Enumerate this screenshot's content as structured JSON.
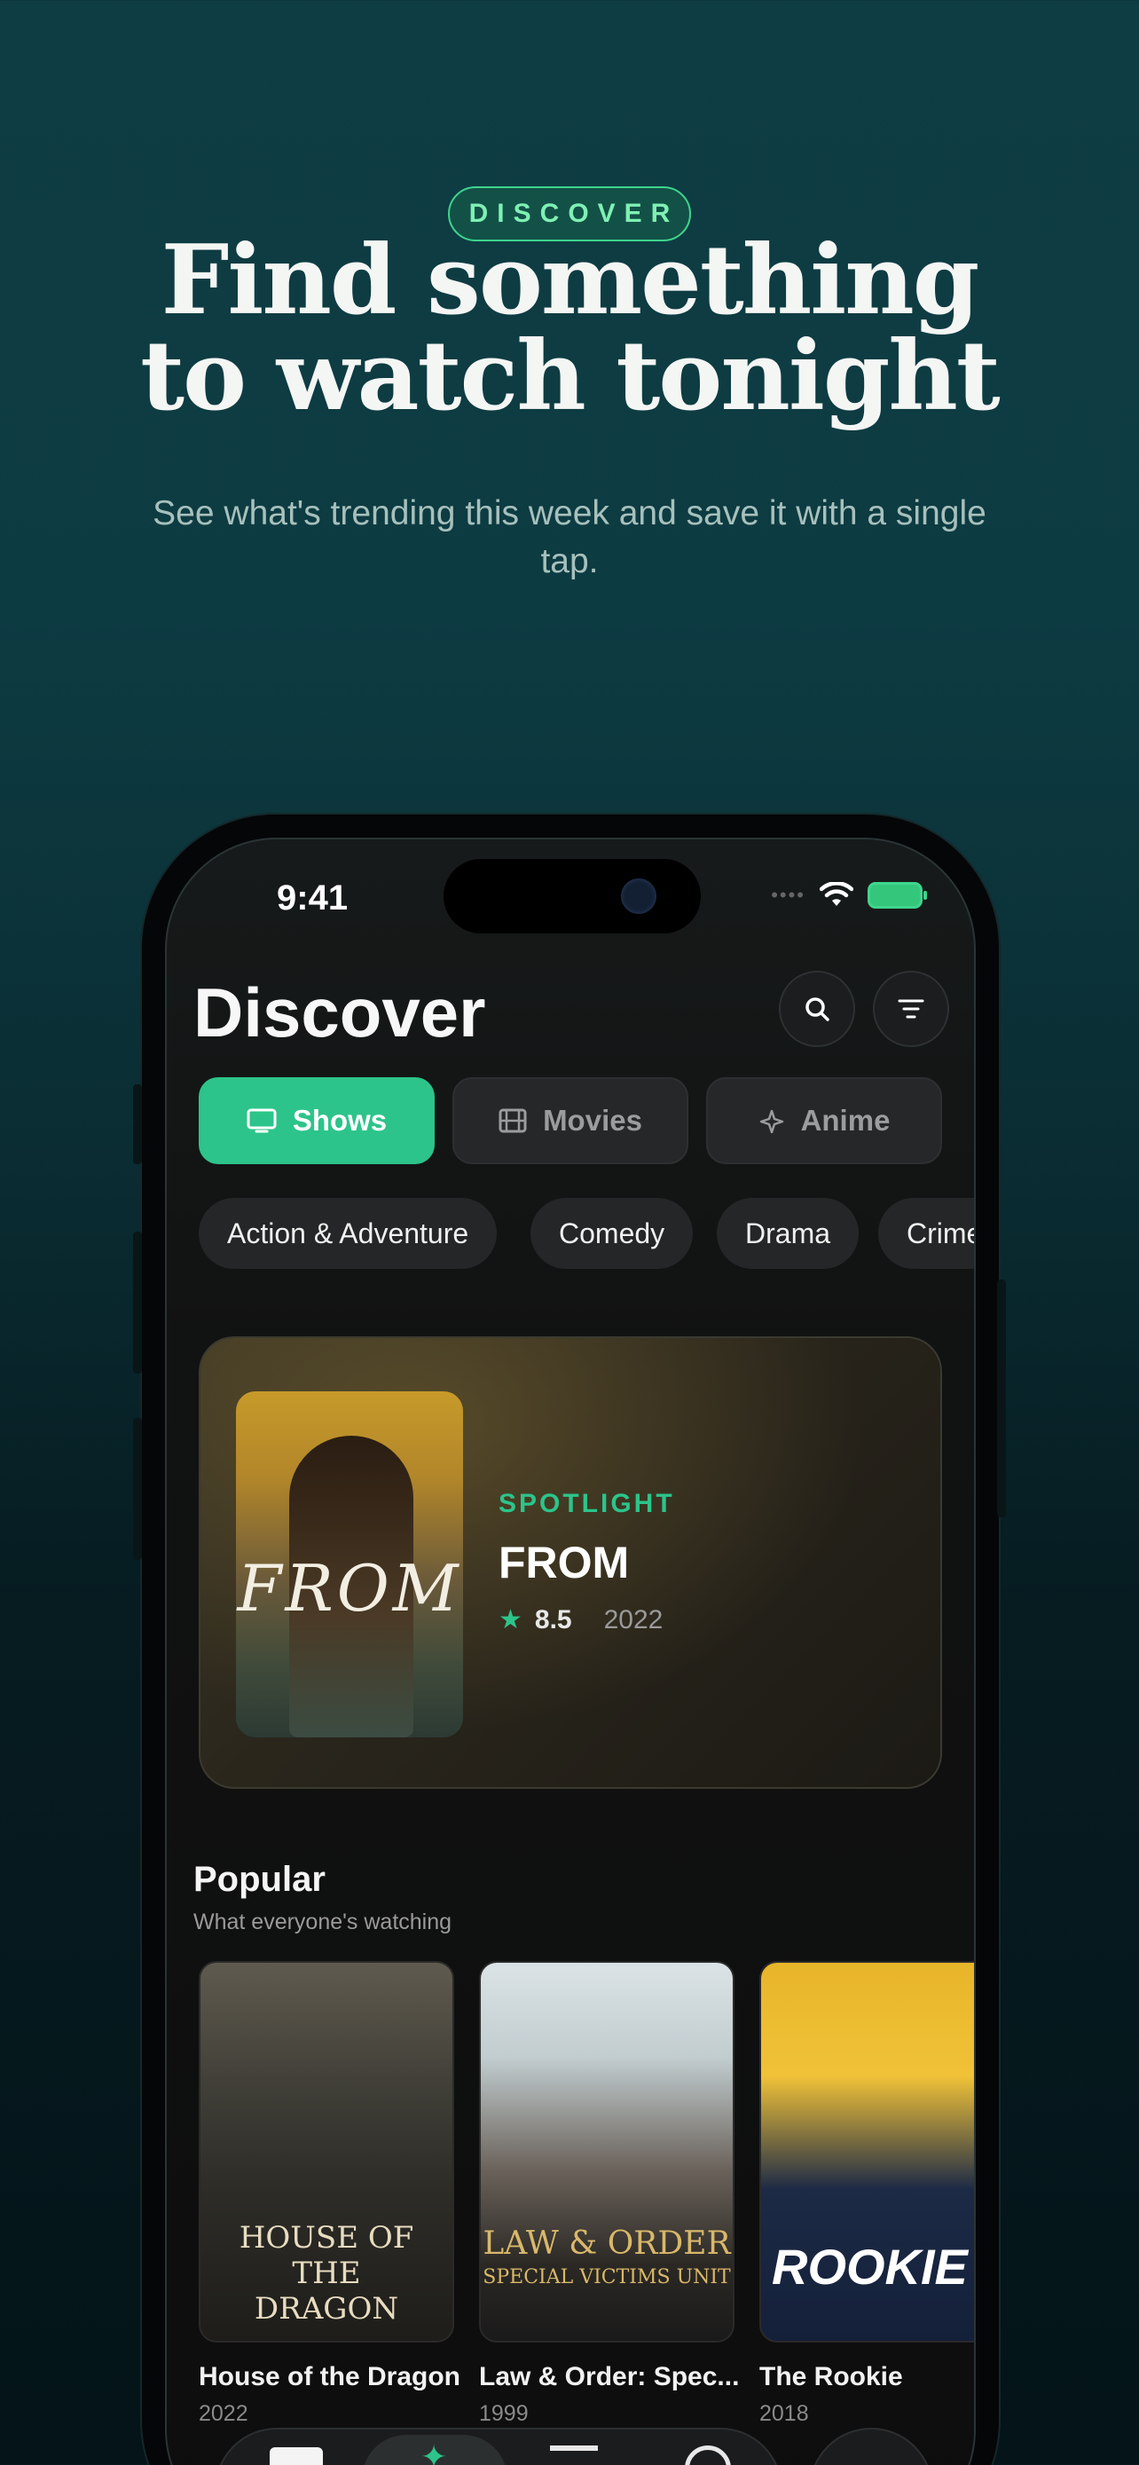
{
  "hero": {
    "badge": "DISCOVER",
    "title_line1": "Find something",
    "title_line2": "to watch tonight",
    "subtitle": "See what's trending this week and save it with a single tap."
  },
  "status_bar": {
    "time": "9:41"
  },
  "header": {
    "title": "Discover"
  },
  "segments": [
    {
      "label": "Shows",
      "icon": "tv-icon",
      "active": true
    },
    {
      "label": "Movies",
      "icon": "film-icon",
      "active": false
    },
    {
      "label": "Anime",
      "icon": "sparkle-icon",
      "active": false
    }
  ],
  "genres": [
    "Action & Adventure",
    "Comedy",
    "Drama",
    "Crime"
  ],
  "spotlight": {
    "label": "SPOTLIGHT",
    "title": "FROM",
    "rating": "8.5",
    "year": "2022",
    "poster_text": "FROM"
  },
  "popular": {
    "title": "Popular",
    "subtitle": "What everyone's watching",
    "items": [
      {
        "title": "House of the Dragon",
        "year": "2022",
        "poster_text": "HOUSE OF THE DRAGON"
      },
      {
        "title": "Law & Order: Spec...",
        "year": "1999",
        "poster_text": "LAW & ORDER",
        "poster_subtext": "SPECIAL VICTIMS UNIT"
      },
      {
        "title": "The Rookie",
        "year": "2018",
        "poster_text": "ROOKIE"
      }
    ]
  },
  "colors": {
    "accent": "#2cc48a",
    "badge_text": "#7ff0b3"
  }
}
